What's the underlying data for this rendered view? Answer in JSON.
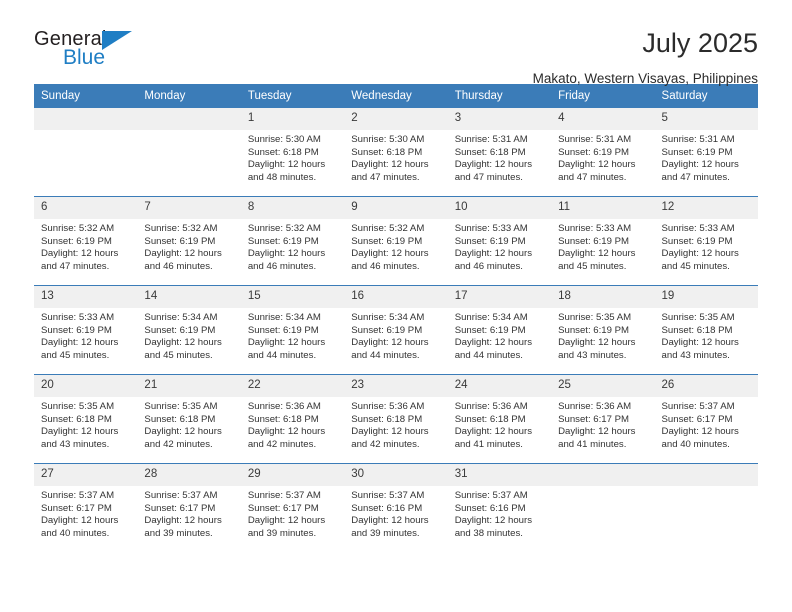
{
  "logo": {
    "word_general": "General",
    "word_blue": "Blue",
    "triangle_icon": "logo-triangle-icon"
  },
  "header": {
    "title": "July 2025",
    "subtitle": "Makato, Western Visayas, Philippines"
  },
  "theme": {
    "header_blue": "#3b7cb8",
    "logo_blue": "#1f7ec4",
    "daynum_bg": "#f0f0f0",
    "text": "#333333"
  },
  "calendar": {
    "weekday_headers": [
      "Sunday",
      "Monday",
      "Tuesday",
      "Wednesday",
      "Thursday",
      "Friday",
      "Saturday"
    ],
    "labels": {
      "sunrise": "Sunrise:",
      "sunset": "Sunset:",
      "daylight": "Daylight:"
    },
    "weeks": [
      [
        {
          "day": "",
          "lines": []
        },
        {
          "day": "",
          "lines": []
        },
        {
          "day": "1",
          "lines": [
            "Sunrise: 5:30 AM",
            "Sunset: 6:18 PM",
            "Daylight: 12 hours",
            "and 48 minutes."
          ]
        },
        {
          "day": "2",
          "lines": [
            "Sunrise: 5:30 AM",
            "Sunset: 6:18 PM",
            "Daylight: 12 hours",
            "and 47 minutes."
          ]
        },
        {
          "day": "3",
          "lines": [
            "Sunrise: 5:31 AM",
            "Sunset: 6:18 PM",
            "Daylight: 12 hours",
            "and 47 minutes."
          ]
        },
        {
          "day": "4",
          "lines": [
            "Sunrise: 5:31 AM",
            "Sunset: 6:19 PM",
            "Daylight: 12 hours",
            "and 47 minutes."
          ]
        },
        {
          "day": "5",
          "lines": [
            "Sunrise: 5:31 AM",
            "Sunset: 6:19 PM",
            "Daylight: 12 hours",
            "and 47 minutes."
          ]
        }
      ],
      [
        {
          "day": "6",
          "lines": [
            "Sunrise: 5:32 AM",
            "Sunset: 6:19 PM",
            "Daylight: 12 hours",
            "and 47 minutes."
          ]
        },
        {
          "day": "7",
          "lines": [
            "Sunrise: 5:32 AM",
            "Sunset: 6:19 PM",
            "Daylight: 12 hours",
            "and 46 minutes."
          ]
        },
        {
          "day": "8",
          "lines": [
            "Sunrise: 5:32 AM",
            "Sunset: 6:19 PM",
            "Daylight: 12 hours",
            "and 46 minutes."
          ]
        },
        {
          "day": "9",
          "lines": [
            "Sunrise: 5:32 AM",
            "Sunset: 6:19 PM",
            "Daylight: 12 hours",
            "and 46 minutes."
          ]
        },
        {
          "day": "10",
          "lines": [
            "Sunrise: 5:33 AM",
            "Sunset: 6:19 PM",
            "Daylight: 12 hours",
            "and 46 minutes."
          ]
        },
        {
          "day": "11",
          "lines": [
            "Sunrise: 5:33 AM",
            "Sunset: 6:19 PM",
            "Daylight: 12 hours",
            "and 45 minutes."
          ]
        },
        {
          "day": "12",
          "lines": [
            "Sunrise: 5:33 AM",
            "Sunset: 6:19 PM",
            "Daylight: 12 hours",
            "and 45 minutes."
          ]
        }
      ],
      [
        {
          "day": "13",
          "lines": [
            "Sunrise: 5:33 AM",
            "Sunset: 6:19 PM",
            "Daylight: 12 hours",
            "and 45 minutes."
          ]
        },
        {
          "day": "14",
          "lines": [
            "Sunrise: 5:34 AM",
            "Sunset: 6:19 PM",
            "Daylight: 12 hours",
            "and 45 minutes."
          ]
        },
        {
          "day": "15",
          "lines": [
            "Sunrise: 5:34 AM",
            "Sunset: 6:19 PM",
            "Daylight: 12 hours",
            "and 44 minutes."
          ]
        },
        {
          "day": "16",
          "lines": [
            "Sunrise: 5:34 AM",
            "Sunset: 6:19 PM",
            "Daylight: 12 hours",
            "and 44 minutes."
          ]
        },
        {
          "day": "17",
          "lines": [
            "Sunrise: 5:34 AM",
            "Sunset: 6:19 PM",
            "Daylight: 12 hours",
            "and 44 minutes."
          ]
        },
        {
          "day": "18",
          "lines": [
            "Sunrise: 5:35 AM",
            "Sunset: 6:19 PM",
            "Daylight: 12 hours",
            "and 43 minutes."
          ]
        },
        {
          "day": "19",
          "lines": [
            "Sunrise: 5:35 AM",
            "Sunset: 6:18 PM",
            "Daylight: 12 hours",
            "and 43 minutes."
          ]
        }
      ],
      [
        {
          "day": "20",
          "lines": [
            "Sunrise: 5:35 AM",
            "Sunset: 6:18 PM",
            "Daylight: 12 hours",
            "and 43 minutes."
          ]
        },
        {
          "day": "21",
          "lines": [
            "Sunrise: 5:35 AM",
            "Sunset: 6:18 PM",
            "Daylight: 12 hours",
            "and 42 minutes."
          ]
        },
        {
          "day": "22",
          "lines": [
            "Sunrise: 5:36 AM",
            "Sunset: 6:18 PM",
            "Daylight: 12 hours",
            "and 42 minutes."
          ]
        },
        {
          "day": "23",
          "lines": [
            "Sunrise: 5:36 AM",
            "Sunset: 6:18 PM",
            "Daylight: 12 hours",
            "and 42 minutes."
          ]
        },
        {
          "day": "24",
          "lines": [
            "Sunrise: 5:36 AM",
            "Sunset: 6:18 PM",
            "Daylight: 12 hours",
            "and 41 minutes."
          ]
        },
        {
          "day": "25",
          "lines": [
            "Sunrise: 5:36 AM",
            "Sunset: 6:17 PM",
            "Daylight: 12 hours",
            "and 41 minutes."
          ]
        },
        {
          "day": "26",
          "lines": [
            "Sunrise: 5:37 AM",
            "Sunset: 6:17 PM",
            "Daylight: 12 hours",
            "and 40 minutes."
          ]
        }
      ],
      [
        {
          "day": "27",
          "lines": [
            "Sunrise: 5:37 AM",
            "Sunset: 6:17 PM",
            "Daylight: 12 hours",
            "and 40 minutes."
          ]
        },
        {
          "day": "28",
          "lines": [
            "Sunrise: 5:37 AM",
            "Sunset: 6:17 PM",
            "Daylight: 12 hours",
            "and 39 minutes."
          ]
        },
        {
          "day": "29",
          "lines": [
            "Sunrise: 5:37 AM",
            "Sunset: 6:17 PM",
            "Daylight: 12 hours",
            "and 39 minutes."
          ]
        },
        {
          "day": "30",
          "lines": [
            "Sunrise: 5:37 AM",
            "Sunset: 6:16 PM",
            "Daylight: 12 hours",
            "and 39 minutes."
          ]
        },
        {
          "day": "31",
          "lines": [
            "Sunrise: 5:37 AM",
            "Sunset: 6:16 PM",
            "Daylight: 12 hours",
            "and 38 minutes."
          ]
        },
        {
          "day": "",
          "lines": []
        },
        {
          "day": "",
          "lines": []
        }
      ]
    ]
  }
}
